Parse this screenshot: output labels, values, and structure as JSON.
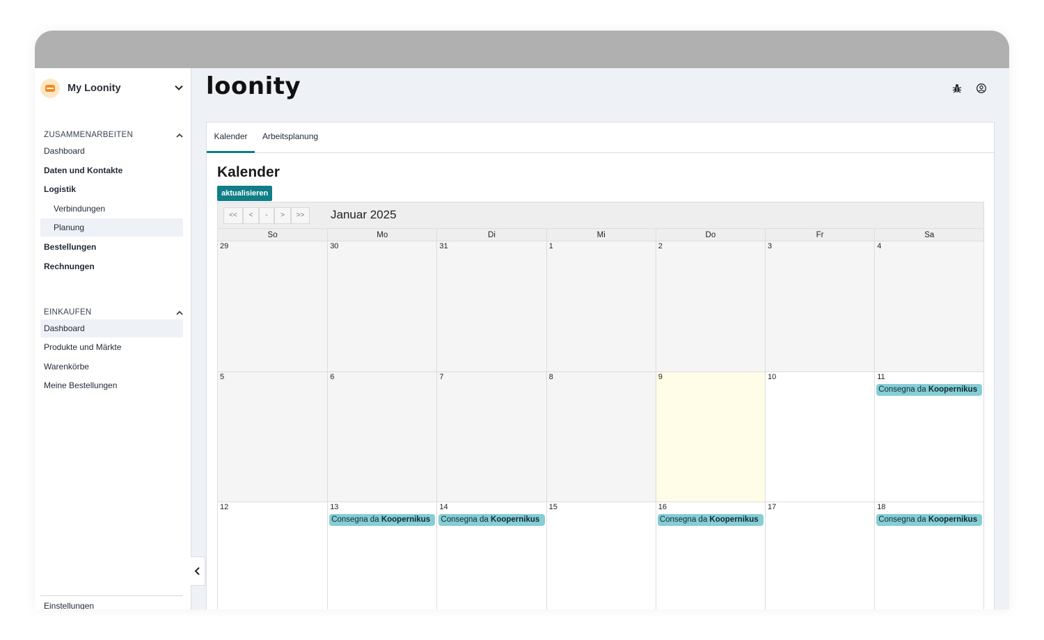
{
  "org": {
    "name": "My Loonity"
  },
  "sidebar": {
    "sections": [
      {
        "title": "ZUSAMMENARBEITEN",
        "items": [
          {
            "label": "Dashboard"
          },
          {
            "label": "Daten und Kontakte"
          },
          {
            "label": "Logistik"
          },
          {
            "label": "Verbindungen"
          },
          {
            "label": "Planung"
          },
          {
            "label": "Bestellungen"
          },
          {
            "label": "Rechnungen"
          }
        ]
      },
      {
        "title": "EINKAUFEN",
        "items": [
          {
            "label": "Dashboard"
          },
          {
            "label": "Produkte und Märkte"
          },
          {
            "label": "Warenkörbe"
          },
          {
            "label": "Meine Bestellungen"
          }
        ]
      }
    ],
    "settings": "Einstellungen"
  },
  "header": {
    "brand": "loonity"
  },
  "tabs": [
    {
      "label": "Kalender"
    },
    {
      "label": "Arbeitsplanung"
    }
  ],
  "calendar": {
    "title": "Kalender",
    "refresh_label": "aktualisieren",
    "nav": [
      "<<",
      "<",
      "-",
      ">",
      ">>"
    ],
    "month_label": "Januar 2025",
    "weekdays": [
      "So",
      "Mo",
      "Di",
      "Mi",
      "Do",
      "Fr",
      "Sa"
    ],
    "event_prefix": "Consegna da ",
    "event_name": "Koopernikus",
    "weeks": [
      [
        {
          "day": "29",
          "muted": true
        },
        {
          "day": "30",
          "muted": true
        },
        {
          "day": "31",
          "muted": true
        },
        {
          "day": "1",
          "muted": true
        },
        {
          "day": "2",
          "muted": true
        },
        {
          "day": "3",
          "muted": true
        },
        {
          "day": "4",
          "muted": true
        }
      ],
      [
        {
          "day": "5",
          "muted": true
        },
        {
          "day": "6",
          "muted": true
        },
        {
          "day": "7",
          "muted": true
        },
        {
          "day": "8",
          "muted": true
        },
        {
          "day": "9",
          "today": true
        },
        {
          "day": "10"
        },
        {
          "day": "11",
          "event": true
        }
      ],
      [
        {
          "day": "12"
        },
        {
          "day": "13",
          "event": true
        },
        {
          "day": "14",
          "event": true
        },
        {
          "day": "15"
        },
        {
          "day": "16",
          "event": true
        },
        {
          "day": "17"
        },
        {
          "day": "18",
          "event": true
        }
      ]
    ]
  }
}
